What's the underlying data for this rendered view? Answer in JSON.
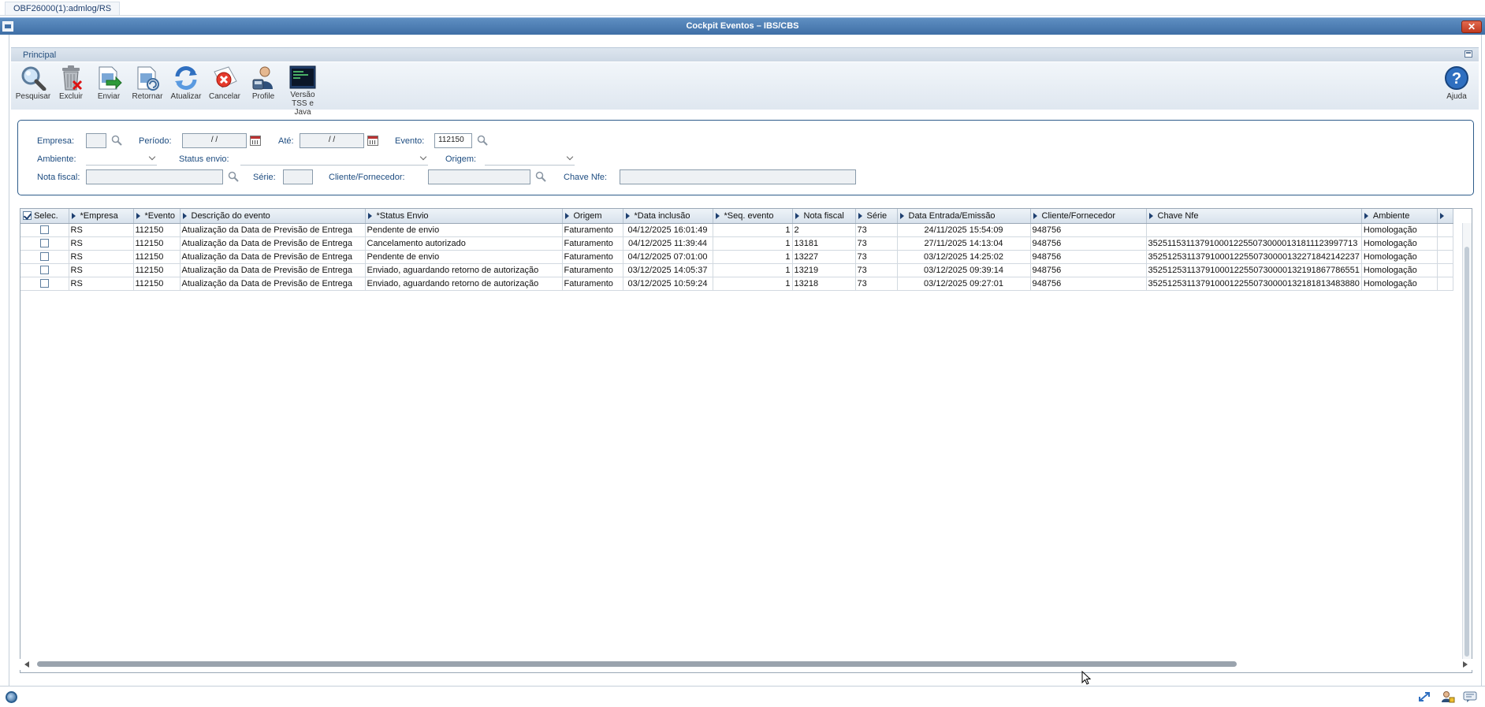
{
  "top_tab": {
    "label": "OBF26000(1):admlog/RS"
  },
  "window": {
    "title": "Cockpit Eventos – IBS/CBS"
  },
  "section": {
    "label": "Principal"
  },
  "toolbar": {
    "pesquisar": "Pesquisar",
    "excluir": "Excluir",
    "enviar": "Enviar",
    "retornar": "Retornar",
    "atualizar": "Atualizar",
    "cancelar": "Cancelar",
    "profile": "Profile",
    "versao_line1": "Versão",
    "versao_line2": "TSS e Java",
    "ajuda": "Ajuda"
  },
  "filters": {
    "empresa_label": "Empresa:",
    "empresa_value": "",
    "periodo_label": "Período:",
    "periodo_value": " / /",
    "ate_label": "Até:",
    "ate_value": " / /",
    "evento_label": "Evento:",
    "evento_value": "112150",
    "ambiente_label": "Ambiente:",
    "ambiente_value": "",
    "status_envio_label": "Status envio:",
    "status_envio_value": "",
    "origem_label": "Origem:",
    "origem_value": "",
    "nota_fiscal_label": "Nota fiscal:",
    "nota_fiscal_value": "",
    "serie_label": "Série:",
    "serie_value": "",
    "cliente_label": "Cliente/Fornecedor:",
    "cliente_value": "",
    "chave_label": "Chave Nfe:",
    "chave_value": ""
  },
  "grid": {
    "columns": [
      "Selec.",
      "*Empresa",
      "*Evento",
      "Descrição do evento",
      "*Status Envio",
      "Origem",
      "*Data inclusão",
      "*Seq. evento",
      "Nota fiscal",
      "Série",
      "Data Entrada/Emissão",
      "Cliente/Fornecedor",
      "Chave Nfe",
      "Ambiente"
    ],
    "rows": [
      [
        "",
        "RS",
        "112150",
        "Atualização da Data de Previsão de Entrega",
        "Pendente de envio",
        "Faturamento",
        "04/12/2025 16:01:49",
        "1",
        "2",
        "73",
        "24/11/2025 15:54:09",
        "948756",
        "",
        "Homologação"
      ],
      [
        "",
        "RS",
        "112150",
        "Atualização da Data de Previsão de Entrega",
        "Cancelamento autorizado",
        "Faturamento",
        "04/12/2025 11:39:44",
        "1",
        "13181",
        "73",
        "27/11/2025 14:13:04",
        "948756",
        "35251153113791000122550730000131811123997713",
        "Homologação"
      ],
      [
        "",
        "RS",
        "112150",
        "Atualização da Data de Previsão de Entrega",
        "Pendente de envio",
        "Faturamento",
        "04/12/2025 07:01:00",
        "1",
        "13227",
        "73",
        "03/12/2025 14:25:02",
        "948756",
        "35251253113791000122550730000132271842142237",
        "Homologação"
      ],
      [
        "",
        "RS",
        "112150",
        "Atualização da Data de Previsão de Entrega",
        "Enviado, aguardando retorno de autorização",
        "Faturamento",
        "03/12/2025 14:05:37",
        "1",
        "13219",
        "73",
        "03/12/2025 09:39:14",
        "948756",
        "35251253113791000122550730000132191867786551",
        "Homologação"
      ],
      [
        "",
        "RS",
        "112150",
        "Atualização da Data de Previsão de Entrega",
        "Enviado, aguardando retorno de autorização",
        "Faturamento",
        "03/12/2025 10:59:24",
        "1",
        "13218",
        "73",
        "03/12/2025 09:27:01",
        "948756",
        "35251253113791000122550730000132181813483880",
        "Homologação"
      ]
    ]
  }
}
